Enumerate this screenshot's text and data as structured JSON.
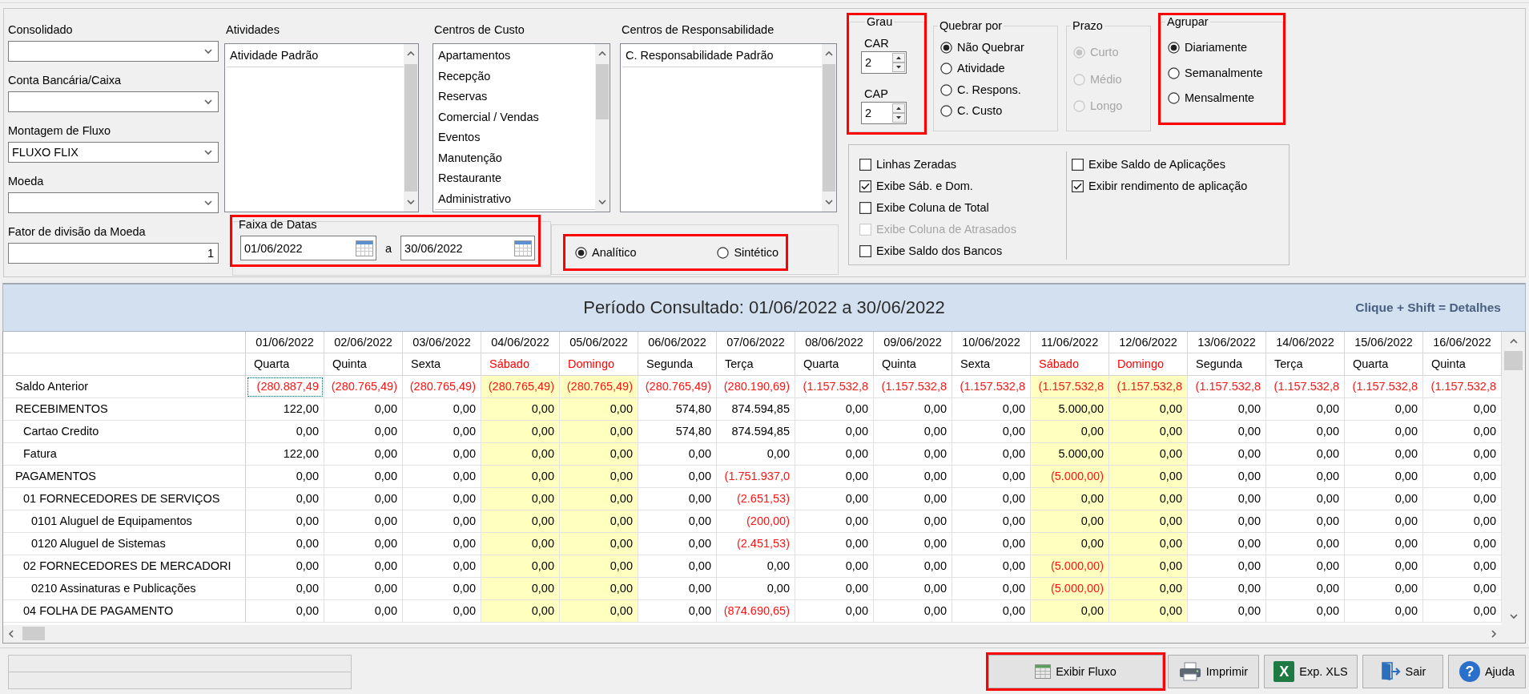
{
  "filters": [
    {
      "label": "Consolidado",
      "kind": "dropdown"
    },
    {
      "label": "Conta Bancária/Caixa",
      "kind": "dropdown"
    },
    {
      "label": "Montagem de Fluxo",
      "kind": "dropdown",
      "value": "FLUXO FLIX"
    },
    {
      "label": "Moeda",
      "kind": "dropdown"
    },
    {
      "label": "Fator de divisão da Moeda",
      "kind": "number",
      "value": "1"
    }
  ],
  "lists": [
    {
      "title": "Atividades",
      "items": [
        "Atividade Padrão"
      ]
    },
    {
      "title": "Centros de Custo",
      "items": [
        "Apartamentos",
        "Recepção",
        "Reservas",
        "Comercial / Vendas",
        "Eventos",
        "Manutenção",
        "Restaurante",
        "Administrativo"
      ]
    },
    {
      "title": "Centros de Responsabilidade",
      "items": [
        "C. Responsabilidade Padrão"
      ]
    }
  ],
  "date_range": {
    "title": "Faixa de Datas",
    "from": "01/06/2022",
    "separator": "a",
    "to": "30/06/2022",
    "highlighted": true
  },
  "report_type": {
    "highlighted": true,
    "options": [
      {
        "label": "Analítico",
        "selected": true
      },
      {
        "label": "Sintético",
        "selected": false
      }
    ]
  },
  "grau": {
    "title": "Grau",
    "highlighted": true,
    "spinners": [
      {
        "label": "CAR",
        "value": "2"
      },
      {
        "label": "CAP",
        "value": "2"
      }
    ]
  },
  "option_groups": [
    {
      "title": "Quebrar por",
      "highlighted": false,
      "options": [
        {
          "label": "Não Quebrar",
          "selected": true,
          "disabled": false
        },
        {
          "label": "Atividade",
          "selected": false,
          "disabled": false
        },
        {
          "label": "C. Respons.",
          "selected": false,
          "disabled": false
        },
        {
          "label": "C. Custo",
          "selected": false,
          "disabled": false
        }
      ]
    },
    {
      "title": "Prazo",
      "highlighted": false,
      "options": [
        {
          "label": "Curto",
          "selected": true,
          "disabled": true
        },
        {
          "label": "Médio",
          "selected": false,
          "disabled": true
        },
        {
          "label": "Longo",
          "selected": false,
          "disabled": true
        }
      ]
    },
    {
      "title": "Agrupar",
      "highlighted": true,
      "options": [
        {
          "label": "Diariamente",
          "selected": true,
          "disabled": false
        },
        {
          "label": "Semanalmente",
          "selected": false,
          "disabled": false
        },
        {
          "label": "Mensalmente",
          "selected": false,
          "disabled": false
        }
      ]
    }
  ],
  "display_options": {
    "columns": [
      [
        {
          "label": "Linhas Zeradas",
          "checked": false,
          "disabled": false
        },
        {
          "label": "Exibe Sáb. e Dom.",
          "checked": true,
          "disabled": false
        },
        {
          "label": "Exibe Coluna de Total",
          "checked": false,
          "disabled": false
        },
        {
          "label": "Exibe Coluna de Atrasados",
          "checked": false,
          "disabled": true
        },
        {
          "label": "Exibe Saldo dos Bancos",
          "checked": false,
          "disabled": false
        }
      ],
      [
        {
          "label": "Exibe Saldo de Aplicações",
          "checked": false,
          "disabled": false
        },
        {
          "label": "Exibir rendimento de aplicação",
          "checked": true,
          "disabled": false
        }
      ]
    ]
  },
  "period_banner": {
    "title": "Período Consultado: 01/06/2022 a 30/06/2022",
    "hint": "Clique + Shift = Detalhes"
  },
  "table": {
    "columns": [
      {
        "date": "01/06/2022",
        "weekday": "Quarta",
        "weekend": false
      },
      {
        "date": "02/06/2022",
        "weekday": "Quinta",
        "weekend": false
      },
      {
        "date": "03/06/2022",
        "weekday": "Sexta",
        "weekend": false
      },
      {
        "date": "04/06/2022",
        "weekday": "Sábado",
        "weekend": true
      },
      {
        "date": "05/06/2022",
        "weekday": "Domingo",
        "weekend": true
      },
      {
        "date": "06/06/2022",
        "weekday": "Segunda",
        "weekend": false
      },
      {
        "date": "07/06/2022",
        "weekday": "Terça",
        "weekend": false
      },
      {
        "date": "08/06/2022",
        "weekday": "Quarta",
        "weekend": false
      },
      {
        "date": "09/06/2022",
        "weekday": "Quinta",
        "weekend": false
      },
      {
        "date": "10/06/2022",
        "weekday": "Sexta",
        "weekend": false
      },
      {
        "date": "11/06/2022",
        "weekday": "Sábado",
        "weekend": true
      },
      {
        "date": "12/06/2022",
        "weekday": "Domingo",
        "weekend": true
      },
      {
        "date": "13/06/2022",
        "weekday": "Segunda",
        "weekend": false
      },
      {
        "date": "14/06/2022",
        "weekday": "Terça",
        "weekend": false
      },
      {
        "date": "15/06/2022",
        "weekday": "Quarta",
        "weekend": false
      },
      {
        "date": "16/06/2022",
        "weekday": "Quinta",
        "weekend": false
      }
    ],
    "rows": [
      {
        "label": "Saldo Anterior",
        "values": [
          "(280.887,49",
          "(280.765,49)",
          "(280.765,49)",
          "(280.765,49)",
          "(280.765,49)",
          "(280.765,49)",
          "(280.190,69)",
          "(1.157.532,8",
          "(1.157.532,8",
          "(1.157.532,8",
          "(1.157.532,8",
          "(1.157.532,8",
          "(1.157.532,8",
          "(1.157.532,8",
          "(1.157.532,8",
          "(1.157.532,8"
        ],
        "negative": [
          true,
          true,
          true,
          true,
          true,
          true,
          true,
          true,
          true,
          true,
          true,
          true,
          true,
          true,
          true,
          true
        ],
        "focused": [
          true,
          false,
          false,
          false,
          false,
          false,
          false,
          false,
          false,
          false,
          false,
          false,
          false,
          false,
          false,
          false
        ]
      },
      {
        "label": "RECEBIMENTOS",
        "values": [
          "122,00",
          "0,00",
          "0,00",
          "0,00",
          "0,00",
          "574,80",
          "874.594,85",
          "0,00",
          "0,00",
          "0,00",
          "5.000,00",
          "0,00",
          "0,00",
          "0,00",
          "0,00",
          "0,00"
        ],
        "negative": [
          false,
          false,
          false,
          false,
          false,
          false,
          false,
          false,
          false,
          false,
          false,
          false,
          false,
          false,
          false,
          false
        ],
        "focused": [
          false,
          false,
          false,
          false,
          false,
          false,
          false,
          false,
          false,
          false,
          false,
          false,
          false,
          false,
          false,
          false
        ],
        "children": [
          {
            "label": "Cartao Credito",
            "values": [
              "0,00",
              "0,00",
              "0,00",
              "0,00",
              "0,00",
              "574,80",
              "874.594,85",
              "0,00",
              "0,00",
              "0,00",
              "0,00",
              "0,00",
              "0,00",
              "0,00",
              "0,00",
              "0,00"
            ],
            "negative": [
              false,
              false,
              false,
              false,
              false,
              false,
              false,
              false,
              false,
              false,
              false,
              false,
              false,
              false,
              false,
              false
            ],
            "focused": [
              false,
              false,
              false,
              false,
              false,
              false,
              false,
              false,
              false,
              false,
              false,
              false,
              false,
              false,
              false,
              false
            ]
          },
          {
            "label": "Fatura",
            "values": [
              "122,00",
              "0,00",
              "0,00",
              "0,00",
              "0,00",
              "0,00",
              "0,00",
              "0,00",
              "0,00",
              "0,00",
              "5.000,00",
              "0,00",
              "0,00",
              "0,00",
              "0,00",
              "0,00"
            ],
            "negative": [
              false,
              false,
              false,
              false,
              false,
              false,
              false,
              false,
              false,
              false,
              false,
              false,
              false,
              false,
              false,
              false
            ],
            "focused": [
              false,
              false,
              false,
              false,
              false,
              false,
              false,
              false,
              false,
              false,
              false,
              false,
              false,
              false,
              false,
              false
            ]
          }
        ]
      },
      {
        "label": "PAGAMENTOS",
        "values": [
          "0,00",
          "0,00",
          "0,00",
          "0,00",
          "0,00",
          "0,00",
          "(1.751.937,0",
          "0,00",
          "0,00",
          "0,00",
          "(5.000,00)",
          "0,00",
          "0,00",
          "0,00",
          "0,00",
          "0,00"
        ],
        "negative": [
          false,
          false,
          false,
          false,
          false,
          false,
          true,
          false,
          false,
          false,
          true,
          false,
          false,
          false,
          false,
          false
        ],
        "focused": [
          false,
          false,
          false,
          false,
          false,
          false,
          false,
          false,
          false,
          false,
          false,
          false,
          false,
          false,
          false,
          false
        ],
        "children": [
          {
            "label": "01 FORNECEDORES DE SERVIÇOS",
            "values": [
              "0,00",
              "0,00",
              "0,00",
              "0,00",
              "0,00",
              "0,00",
              "(2.651,53)",
              "0,00",
              "0,00",
              "0,00",
              "0,00",
              "0,00",
              "0,00",
              "0,00",
              "0,00",
              "0,00"
            ],
            "negative": [
              false,
              false,
              false,
              false,
              false,
              false,
              true,
              false,
              false,
              false,
              false,
              false,
              false,
              false,
              false,
              false
            ],
            "focused": [
              false,
              false,
              false,
              false,
              false,
              false,
              false,
              false,
              false,
              false,
              false,
              false,
              false,
              false,
              false,
              false
            ],
            "children": [
              {
                "label": "0101 Aluguel de Equipamentos",
                "values": [
                  "0,00",
                  "0,00",
                  "0,00",
                  "0,00",
                  "0,00",
                  "0,00",
                  "(200,00)",
                  "0,00",
                  "0,00",
                  "0,00",
                  "0,00",
                  "0,00",
                  "0,00",
                  "0,00",
                  "0,00",
                  "0,00"
                ],
                "negative": [
                  false,
                  false,
                  false,
                  false,
                  false,
                  false,
                  true,
                  false,
                  false,
                  false,
                  false,
                  false,
                  false,
                  false,
                  false,
                  false
                ],
                "focused": [
                  false,
                  false,
                  false,
                  false,
                  false,
                  false,
                  false,
                  false,
                  false,
                  false,
                  false,
                  false,
                  false,
                  false,
                  false,
                  false
                ]
              },
              {
                "label": "0120 Aluguel de Sistemas",
                "values": [
                  "0,00",
                  "0,00",
                  "0,00",
                  "0,00",
                  "0,00",
                  "0,00",
                  "(2.451,53)",
                  "0,00",
                  "0,00",
                  "0,00",
                  "0,00",
                  "0,00",
                  "0,00",
                  "0,00",
                  "0,00",
                  "0,00"
                ],
                "negative": [
                  false,
                  false,
                  false,
                  false,
                  false,
                  false,
                  true,
                  false,
                  false,
                  false,
                  false,
                  false,
                  false,
                  false,
                  false,
                  false
                ],
                "focused": [
                  false,
                  false,
                  false,
                  false,
                  false,
                  false,
                  false,
                  false,
                  false,
                  false,
                  false,
                  false,
                  false,
                  false,
                  false,
                  false
                ]
              }
            ]
          },
          {
            "label": "02 FORNECEDORES DE MERCADORI",
            "values": [
              "0,00",
              "0,00",
              "0,00",
              "0,00",
              "0,00",
              "0,00",
              "0,00",
              "0,00",
              "0,00",
              "0,00",
              "(5.000,00)",
              "0,00",
              "0,00",
              "0,00",
              "0,00",
              "0,00"
            ],
            "negative": [
              false,
              false,
              false,
              false,
              false,
              false,
              false,
              false,
              false,
              false,
              true,
              false,
              false,
              false,
              false,
              false
            ],
            "focused": [
              false,
              false,
              false,
              false,
              false,
              false,
              false,
              false,
              false,
              false,
              false,
              false,
              false,
              false,
              false,
              false
            ],
            "children": [
              {
                "label": "0210 Assinaturas e Publicações",
                "values": [
                  "0,00",
                  "0,00",
                  "0,00",
                  "0,00",
                  "0,00",
                  "0,00",
                  "0,00",
                  "0,00",
                  "0,00",
                  "0,00",
                  "(5.000,00)",
                  "0,00",
                  "0,00",
                  "0,00",
                  "0,00",
                  "0,00"
                ],
                "negative": [
                  false,
                  false,
                  false,
                  false,
                  false,
                  false,
                  false,
                  false,
                  false,
                  false,
                  true,
                  false,
                  false,
                  false,
                  false,
                  false
                ],
                "focused": [
                  false,
                  false,
                  false,
                  false,
                  false,
                  false,
                  false,
                  false,
                  false,
                  false,
                  false,
                  false,
                  false,
                  false,
                  false,
                  false
                ]
              }
            ]
          },
          {
            "label": "04 FOLHA DE PAGAMENTO",
            "values": [
              "0,00",
              "0,00",
              "0,00",
              "0,00",
              "0,00",
              "0,00",
              "(874.690,65)",
              "0,00",
              "0,00",
              "0,00",
              "0,00",
              "0,00",
              "0,00",
              "0,00",
              "0,00",
              "0,00"
            ],
            "negative": [
              false,
              false,
              false,
              false,
              false,
              false,
              true,
              false,
              false,
              false,
              false,
              false,
              false,
              false,
              false,
              false
            ],
            "focused": [
              false,
              false,
              false,
              false,
              false,
              false,
              false,
              false,
              false,
              false,
              false,
              false,
              false,
              false,
              false,
              false
            ]
          }
        ]
      }
    ]
  },
  "buttons": [
    {
      "label": "Exibir Fluxo",
      "kind": "show",
      "highlighted": true
    },
    {
      "label": "Imprimir",
      "kind": "print",
      "highlighted": false
    },
    {
      "label": "Exp. XLS",
      "kind": "export",
      "glyph": "X",
      "highlighted": false
    },
    {
      "label": "Sair",
      "kind": "exit",
      "highlighted": false
    },
    {
      "label": "Ajuda",
      "kind": "help",
      "glyph": "?",
      "highlighted": false
    }
  ]
}
